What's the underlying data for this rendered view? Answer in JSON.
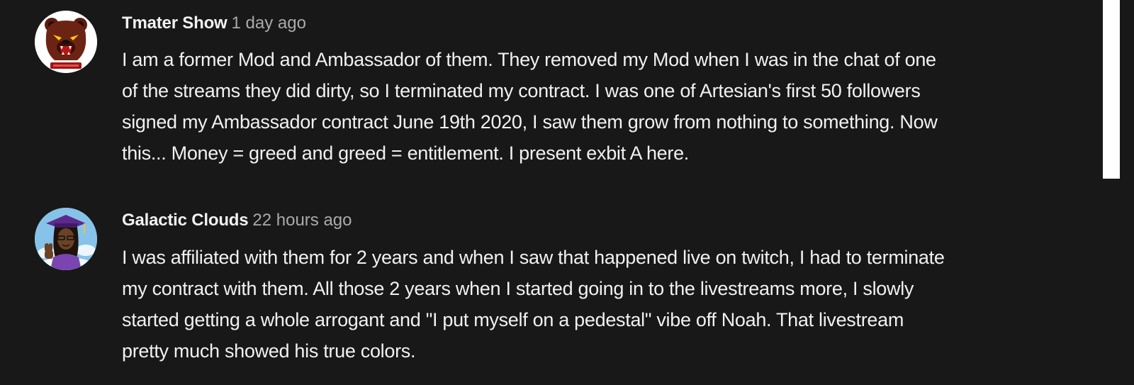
{
  "comments": [
    {
      "author": "Tmater Show",
      "time": "1 day ago",
      "avatar_icon": "bear-logo-icon",
      "text_lines": [
        "I am a former Mod and Ambassador of them. They removed my Mod when I was in the chat of one",
        "of the streams they did dirty, so I terminated my contract. I was one of Artesian's first 50 followers",
        "signed my Ambassador contract June 19th 2020, I saw them grow from nothing to something. Now",
        "this... Money = greed and greed = entitlement. I present exbit A here."
      ]
    },
    {
      "author": "Galactic Clouds",
      "time": "22 hours ago",
      "avatar_icon": "graduate-character-icon",
      "text_lines": [
        "I was affiliated with them for 2 years and when I saw that happened live on twitch, I had to terminate",
        "my contract with them. All those 2 years when I started going in to the livestreams more, I slowly",
        "started getting a whole arrogant and \"I put myself on a pedestal\" vibe off Noah. That livestream",
        "pretty much showed his true colors."
      ]
    }
  ],
  "colors": {
    "background": "#181818",
    "author": "#f1f1f1",
    "timestamp": "#aaaaaa",
    "text": "#f1f1f1"
  }
}
